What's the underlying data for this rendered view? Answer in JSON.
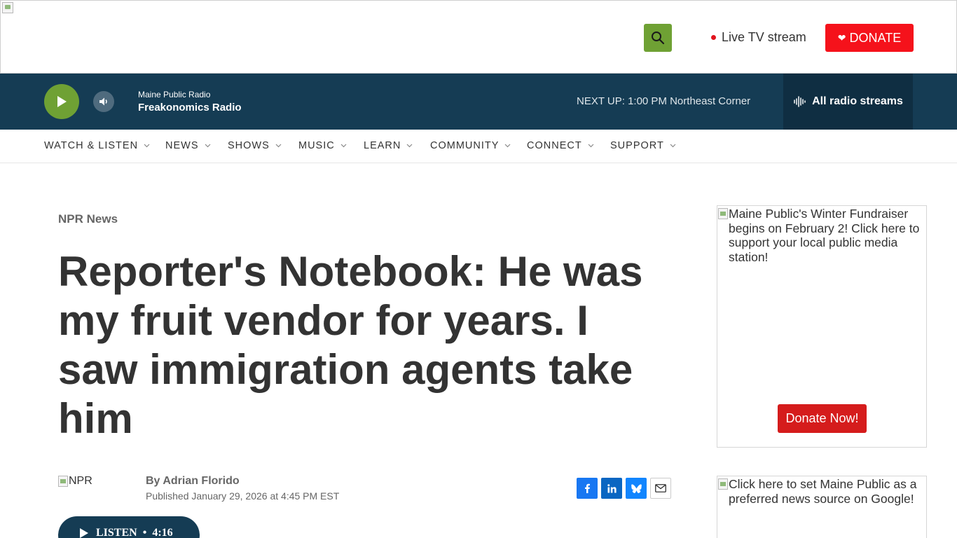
{
  "header": {
    "logo_alt": "",
    "live_tv_label": "Live TV stream",
    "donate_label": "DONATE",
    "colors": {
      "search_bg": "#6fa134",
      "donate_bg": "#f5121b",
      "live_dot": "#e1141e"
    }
  },
  "player": {
    "station": "Maine Public Radio",
    "program": "Freakonomics Radio",
    "next_up": "NEXT UP: 1:00 PM Northeast Corner",
    "streams_label": "All radio streams",
    "colors": {
      "bar_bg": "#153c54",
      "play_bg": "#6fa134",
      "streams_bg": "#0f2e42"
    }
  },
  "nav": {
    "items": [
      {
        "label": "WATCH & LISTEN"
      },
      {
        "label": "NEWS"
      },
      {
        "label": "SHOWS"
      },
      {
        "label": "MUSIC"
      },
      {
        "label": "LEARN"
      },
      {
        "label": "COMMUNITY"
      },
      {
        "label": "CONNECT"
      },
      {
        "label": "SUPPORT"
      }
    ]
  },
  "article": {
    "section": "NPR News",
    "headline": "Reporter's Notebook: He was my fruit vendor for years. I saw immigration agents take him",
    "byline_image_alt": "NPR",
    "byline_prefix": "By ",
    "author": "Adrian Florido",
    "published": "Published January 29, 2026 at 4:45 PM EST",
    "listen_label": "LISTEN",
    "listen_separator": "•",
    "listen_duration": "4:16",
    "share_icons": [
      "facebook-icon",
      "linkedin-icon",
      "bluesky-icon",
      "email-icon"
    ]
  },
  "sidebar": {
    "ad1_alt": "Maine Public's Winter Fundraiser begins on February 2! Click here to support your local public media station!",
    "ad1_button": "Donate Now!",
    "ad2_alt": "Click here to set Maine Public as a preferred news source on Google!"
  }
}
